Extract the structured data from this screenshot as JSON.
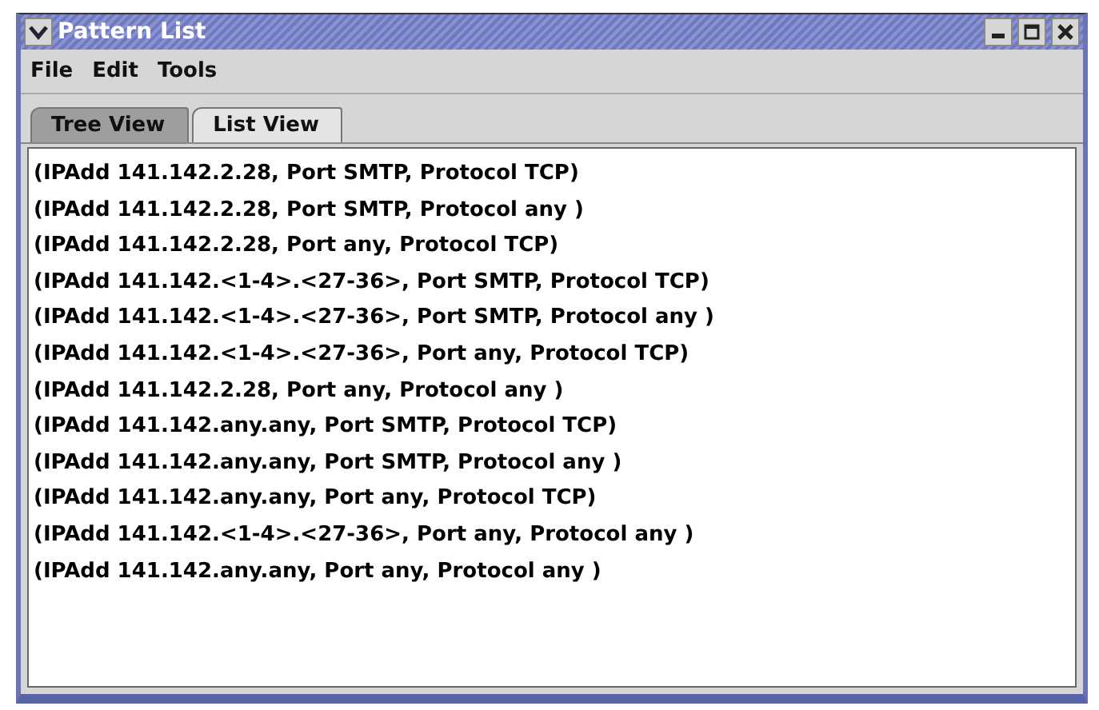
{
  "window": {
    "title": "Pattern List"
  },
  "menu": [
    "File",
    "Edit",
    "Tools"
  ],
  "tabs": [
    {
      "label": "Tree View",
      "selected": false
    },
    {
      "label": "List View",
      "selected": true
    }
  ],
  "list": {
    "items": [
      "(IPAdd 141.142.2.28, Port SMTP, Protocol TCP)",
      "(IPAdd 141.142.2.28, Port SMTP, Protocol any )",
      "(IPAdd 141.142.2.28, Port any, Protocol TCP)",
      "(IPAdd 141.142.<1-4>.<27-36>, Port SMTP, Protocol TCP)",
      "(IPAdd 141.142.<1-4>.<27-36>, Port SMTP, Protocol any )",
      "(IPAdd 141.142.<1-4>.<27-36>, Port any, Protocol TCP)",
      "(IPAdd 141.142.2.28, Port any, Protocol any )",
      "(IPAdd 141.142.any.any, Port SMTP, Protocol TCP)",
      "(IPAdd 141.142.any.any, Port SMTP, Protocol any )",
      "(IPAdd 141.142.any.any, Port any, Protocol TCP)",
      "(IPAdd 141.142.<1-4>.<27-36>, Port any, Protocol any )",
      "(IPAdd 141.142.any.any, Port any, Protocol any )"
    ]
  }
}
